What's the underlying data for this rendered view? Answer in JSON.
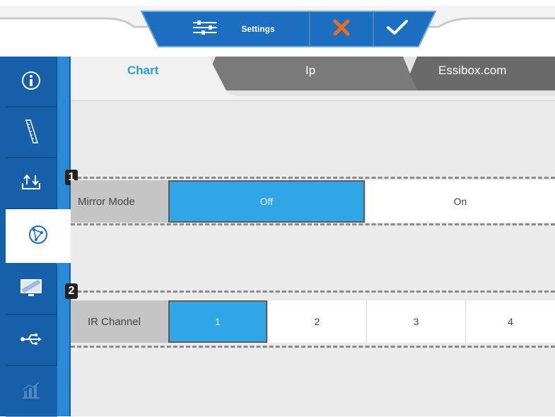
{
  "toolbar": {
    "settings_label": "Settings",
    "icons": [
      "sliders-icon",
      "close-icon",
      "check-icon"
    ],
    "colors": {
      "bar": "#1c6fc0",
      "close": "#ef6a1c",
      "check": "#ffffff"
    }
  },
  "sidebar": {
    "items": [
      {
        "icon": "info-icon",
        "selected": false
      },
      {
        "icon": "ruler-icon",
        "selected": false
      },
      {
        "icon": "upload-download-icon",
        "selected": false
      },
      {
        "icon": "network-icon",
        "selected": true
      },
      {
        "icon": "monitor-icon",
        "selected": false
      },
      {
        "icon": "usb-icon",
        "selected": false
      },
      {
        "icon": "chart-icon",
        "selected": false
      }
    ]
  },
  "tabs": [
    {
      "label": "Chart",
      "selected": true
    },
    {
      "label": "Ip",
      "selected": false
    },
    {
      "label": "Essibox.com",
      "selected": false
    }
  ],
  "settings": {
    "mirror": {
      "badge": "1",
      "label": "Mirror Mode",
      "options": [
        "Off",
        "On"
      ],
      "selected": "Off"
    },
    "ir": {
      "badge": "2",
      "label": "IR Channel",
      "options": [
        "1",
        "2",
        "3",
        "4"
      ],
      "selected": "1"
    }
  },
  "colors": {
    "accent": "#30a6e6",
    "sidebar": "#1560a8",
    "tab_active_text": "#2a9fd6"
  }
}
